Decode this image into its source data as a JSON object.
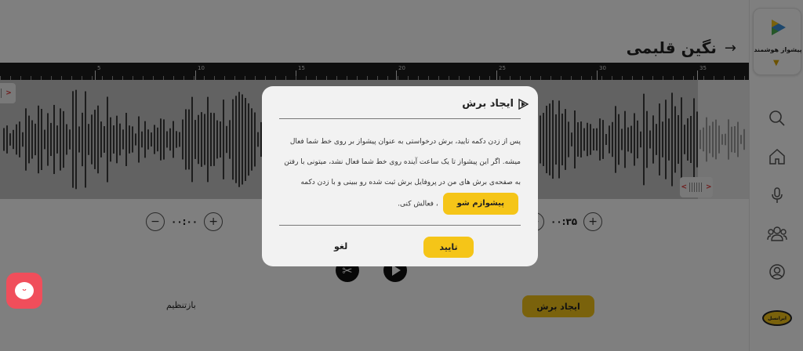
{
  "header": {
    "song_title": "نگین قلبمی",
    "back_icon": "arrow-right-icon"
  },
  "ruler": {
    "ticks": [
      "5",
      "10",
      "15",
      "20",
      "25",
      "30",
      "35"
    ]
  },
  "trim": {
    "start_time": "۰۰:۰۰",
    "end_time": "۰۰:۳۵",
    "minus_label": "−",
    "plus_label": "+",
    "left_handle_arrow": ">",
    "right_handle_left_arrow": "<",
    "right_handle_right_arrow": ">"
  },
  "actions": {
    "create_cut": "ایجاد برش",
    "reset": "بازتنظیم"
  },
  "sidebar": {
    "brand_name": "پیشواز هوشمند",
    "operator_name": "ایرانسل",
    "items": [
      "search-icon",
      "home-icon",
      "microphone-icon",
      "users-icon",
      "profile-icon"
    ]
  },
  "dialog": {
    "title": "ایجاد برش",
    "body_1": "پس از زدن دکمه تایید، برش درخواستی به عنوان پیشواز بر روی خط شما فعال میشه. اگر این پیشواز تا یک ساعت آینده روی خط شما فعال نشد، میتونی با رفتن به صفحه‌ی برش های من در پروفایل برش ثبت شده رو ببینی و با زدن دکمه",
    "inline_button": "پیشوازم شو",
    "body_2": "، فعالش کنی.",
    "confirm": "تایید",
    "cancel": "لغو"
  },
  "colors": {
    "accent": "#f5c518",
    "support": "#f04e5b",
    "ruler": "#1d1d1d"
  }
}
